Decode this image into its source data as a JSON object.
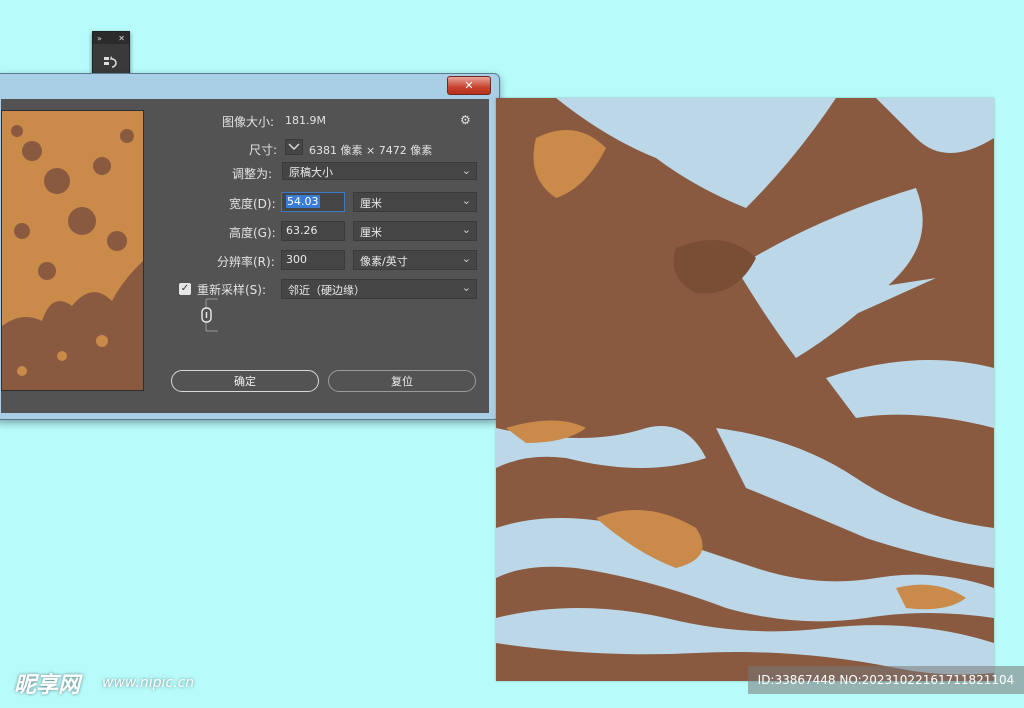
{
  "mini_panel": {
    "expand": "»",
    "close": "✕"
  },
  "dialog": {
    "close_label": "✕",
    "image_size_label": "图像大小:",
    "image_size_value": "181.9M",
    "dimensions_label": "尺寸:",
    "dimensions_value": "6381 像素 × 7472 像素",
    "fit_to_label": "调整为:",
    "fit_to_value": "原稿大小",
    "width_label": "宽度(D):",
    "width_value": "54.03",
    "width_unit": "厘米",
    "height_label": "高度(G):",
    "height_value": "63.26",
    "height_unit": "厘米",
    "resolution_label": "分辨率(R):",
    "resolution_value": "300",
    "resolution_unit": "像素/英寸",
    "resample_label": "重新采样(S):",
    "resample_checked": true,
    "resample_value": "邻近（硬边缘）",
    "ok_label": "确定",
    "reset_label": "复位"
  },
  "watermark": {
    "logo": "昵享网",
    "url": "www.nipic.cn",
    "id_text": "ID:33867448 NO:20231022161711821104"
  },
  "colors": {
    "background": "#b8fbfb",
    "brown": "#8a5a40",
    "orange": "#c98a4a",
    "light_blue": "#bcd8e8"
  }
}
